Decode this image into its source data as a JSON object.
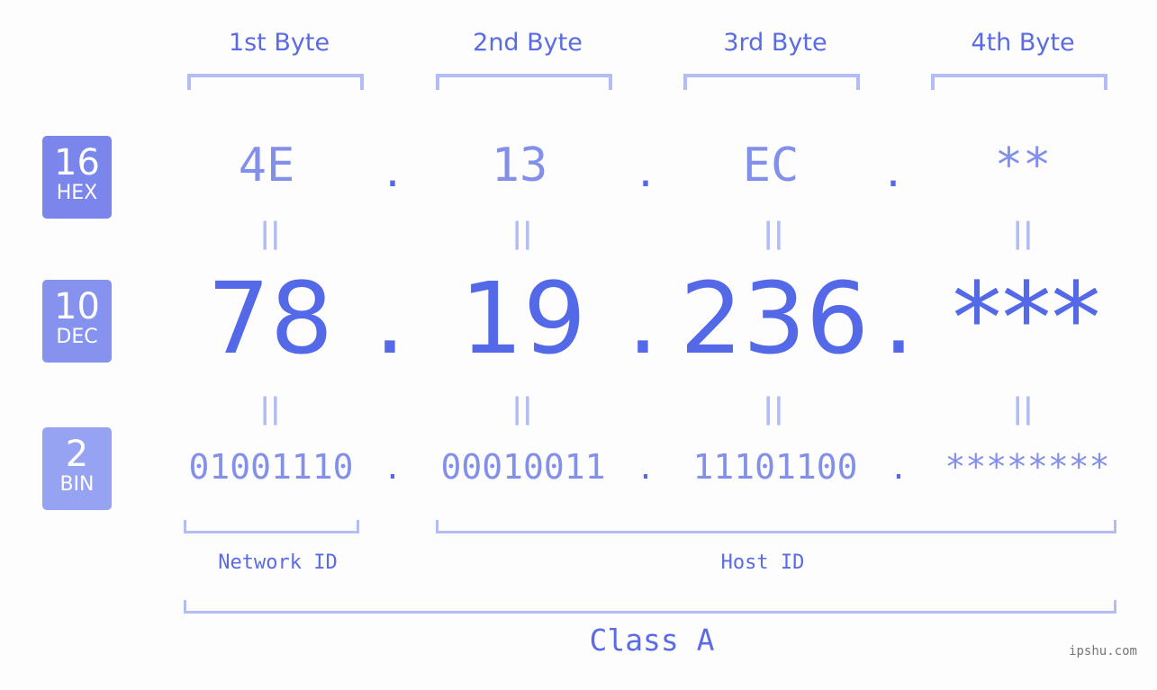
{
  "headers": [
    "1st Byte",
    "2nd Byte",
    "3rd Byte",
    "4th Byte"
  ],
  "rows": {
    "hex": {
      "base": "16",
      "label": "HEX",
      "color": "#7a86ec",
      "values": [
        "4E",
        "13",
        "EC",
        "**"
      ]
    },
    "dec": {
      "base": "10",
      "label": "DEC",
      "color": "#8592ee",
      "values": [
        "78",
        "19",
        "236",
        "***"
      ]
    },
    "bin": {
      "base": "2",
      "label": "BIN",
      "color": "#96a3f2",
      "values": [
        "01001110",
        "00010011",
        "11101100",
        "********"
      ]
    }
  },
  "separator": ".",
  "equals": "||",
  "network_id_label": "Network ID",
  "host_id_label": "Host ID",
  "class_label": "Class A",
  "watermark": "ipshu.com",
  "colors": {
    "accent": "#5469e8",
    "light": "#b4bcf6",
    "mid": "#8390ea"
  }
}
